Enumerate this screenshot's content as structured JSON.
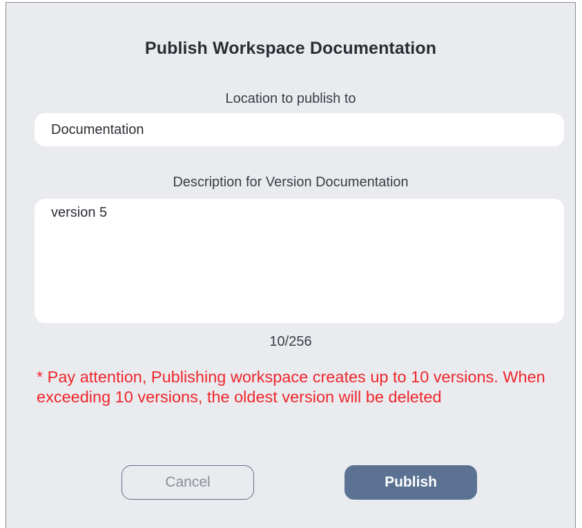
{
  "dialog": {
    "title": "Publish Workspace Documentation",
    "location_label": "Location to publish to",
    "location_value": "Documentation",
    "description_label": "Description for Version Documentation",
    "description_value": "version 5",
    "char_counter": "10/256",
    "warning": "* Pay attention, Publishing workspace creates up to 10 versions. When exceeding 10 versions, the oldest version will be deleted",
    "cancel_label": "Cancel",
    "publish_label": "Publish"
  },
  "colors": {
    "background": "#e9ebef",
    "warning": "#f0262b",
    "primary": "#5b7293"
  }
}
